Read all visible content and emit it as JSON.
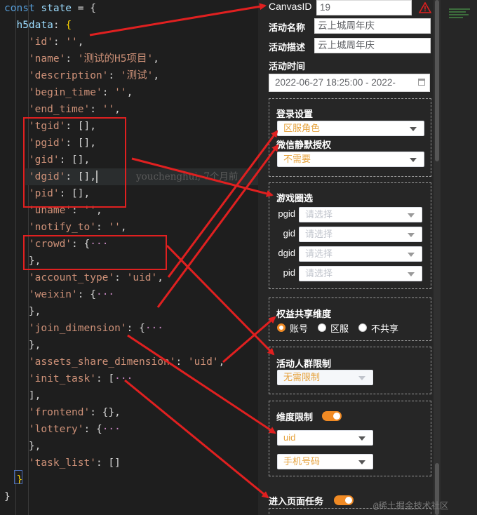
{
  "code": {
    "lines": [
      [
        [
          "const ",
          "k"
        ],
        [
          "state",
          "v"
        ],
        [
          " = {",
          "p"
        ]
      ],
      [
        [
          "  h5data",
          "v"
        ],
        [
          ": ",
          "p"
        ],
        [
          "{",
          "y"
        ]
      ],
      [
        [
          "    'id'",
          "s"
        ],
        [
          ": ",
          "p"
        ],
        [
          "''",
          "s"
        ],
        [
          ",",
          "p"
        ]
      ],
      [
        [
          "    'name'",
          "s"
        ],
        [
          ": ",
          "p"
        ],
        [
          "'测试的H5项目'",
          "s"
        ],
        [
          ",",
          "p"
        ]
      ],
      [
        [
          "    'description'",
          "s"
        ],
        [
          ": ",
          "p"
        ],
        [
          "'测试'",
          "s"
        ],
        [
          ",",
          "p"
        ]
      ],
      [
        [
          "    'begin_time'",
          "s"
        ],
        [
          ": ",
          "p"
        ],
        [
          "''",
          "s"
        ],
        [
          ",",
          "p"
        ]
      ],
      [
        [
          "    'end_time'",
          "s"
        ],
        [
          ": ",
          "p"
        ],
        [
          "''",
          "s"
        ],
        [
          ",",
          "p"
        ]
      ],
      [
        [
          "    'tgid'",
          "s"
        ],
        [
          ": [],",
          "p"
        ]
      ],
      [
        [
          "    'pgid'",
          "s"
        ],
        [
          ": [],",
          "p"
        ]
      ],
      [
        [
          "    'gid'",
          "s"
        ],
        [
          ": [],",
          "p"
        ]
      ],
      [
        [
          "    'dgid'",
          "s"
        ],
        [
          ": [],",
          "p"
        ],
        [
          "",
          "cursor"
        ]
      ],
      [
        [
          "    'pid'",
          "s"
        ],
        [
          ": [],",
          "p"
        ]
      ],
      [
        [
          "    'uname'",
          "s"
        ],
        [
          ": ",
          "p"
        ],
        [
          "''",
          "s"
        ],
        [
          ",",
          "p"
        ]
      ],
      [
        [
          "    'notify_to'",
          "s"
        ],
        [
          ": ",
          "p"
        ],
        [
          "''",
          "s"
        ],
        [
          ",",
          "p"
        ]
      ],
      [
        [
          "    'crowd'",
          "s"
        ],
        [
          ": {",
          "p"
        ],
        [
          "···",
          "m"
        ]
      ],
      [
        [
          "    },",
          "p"
        ]
      ],
      [
        [
          "    'account_type'",
          "s"
        ],
        [
          ": ",
          "p"
        ],
        [
          "'uid'",
          "s"
        ],
        [
          ",",
          "p"
        ]
      ],
      [
        [
          "    'weixin'",
          "s"
        ],
        [
          ": {",
          "p"
        ],
        [
          "···",
          "m"
        ]
      ],
      [
        [
          "    },",
          "p"
        ]
      ],
      [
        [
          "    'join_dimension'",
          "s"
        ],
        [
          ": {",
          "p"
        ],
        [
          "···",
          "m"
        ]
      ],
      [
        [
          "    },",
          "p"
        ]
      ],
      [
        [
          "    'assets_share_dimension'",
          "s"
        ],
        [
          ": ",
          "p"
        ],
        [
          "'uid'",
          "s"
        ],
        [
          ",",
          "p"
        ]
      ],
      [
        [
          "    'init_task'",
          "s"
        ],
        [
          ": [",
          "p"
        ],
        [
          "···",
          "m"
        ]
      ],
      [
        [
          "    ],",
          "p"
        ]
      ],
      [
        [
          "    'frontend'",
          "s"
        ],
        [
          ": {},",
          "p"
        ]
      ],
      [
        [
          "    'lottery'",
          "s"
        ],
        [
          ": {",
          "p"
        ],
        [
          "···",
          "m"
        ]
      ],
      [
        [
          "    },",
          "p"
        ]
      ],
      [
        [
          "    'task_list'",
          "s"
        ],
        [
          ": []",
          "p"
        ]
      ],
      [
        [
          "  }",
          "y"
        ]
      ],
      [
        [
          "}",
          "p"
        ]
      ]
    ],
    "ghost_text": "youchenghui, 7个月前"
  },
  "form": {
    "canvas_label": "CanvasID",
    "canvas_value": "19",
    "name_label": "活动名称",
    "name_value": "云上城周年庆",
    "desc_label": "活动描述",
    "desc_value": "云上城周年庆",
    "time_label": "活动时间",
    "time_value": "2022-06-27 18:25:00 - 2022-",
    "login_title": "登录设置",
    "login_select": "区服角色",
    "wechat_label": "微信静默授权",
    "wechat_select": "不需要",
    "game_title": "游戏圈选",
    "pgid_label": "pgid",
    "gid_label": "gid",
    "dgid_label": "dgid",
    "pid_label": "pid",
    "placeholder": "请选择",
    "share_title": "权益共享维度",
    "radio_account": "账号",
    "radio_server": "区服",
    "radio_none": "不共享",
    "crowd_title": "活动人群限制",
    "crowd_select": "无需限制",
    "dim_title": "维度限制",
    "dim_select": "uid",
    "dim_select2": "手机号码",
    "enter_task": "进入页面任务"
  },
  "watermark": "@稀土掘金技术社区",
  "colors": {
    "accent": "#f08a24",
    "arrow": "#e02020",
    "warning": "#e02020"
  }
}
